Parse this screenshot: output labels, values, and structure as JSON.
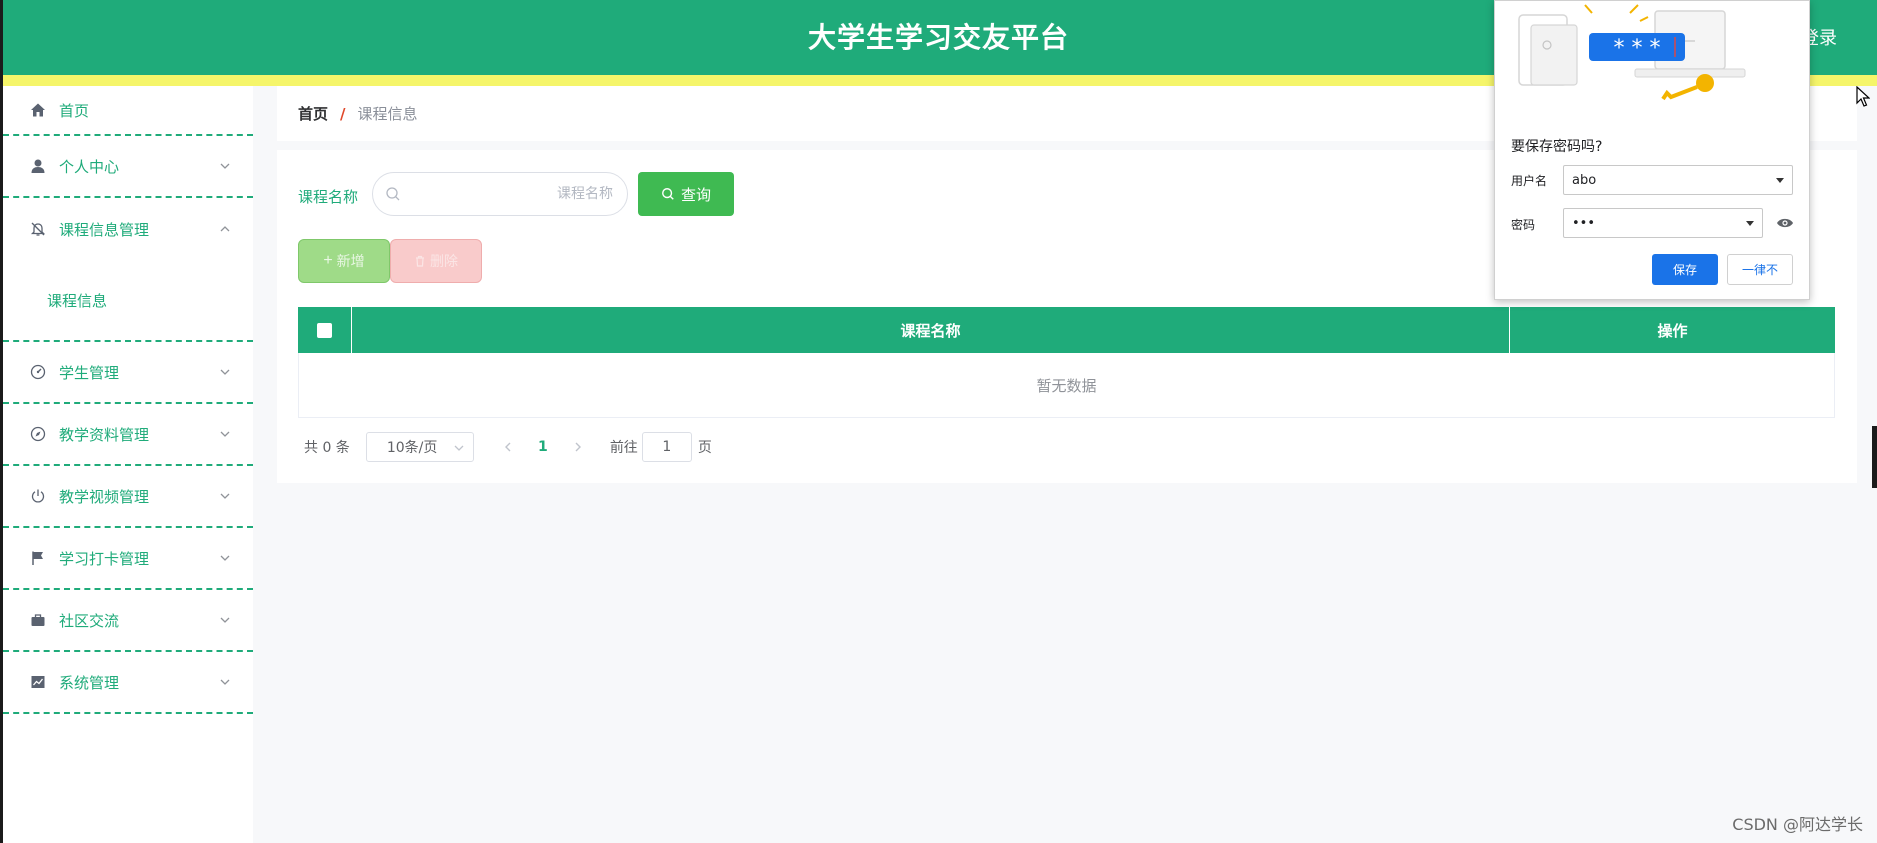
{
  "header": {
    "title": "大学生学习交友平台",
    "login_label": "登录"
  },
  "sidebar": {
    "items": [
      {
        "label": "首页",
        "icon": "home-icon"
      },
      {
        "label": "个人中心",
        "icon": "user-icon"
      },
      {
        "label": "课程信息管理",
        "icon": "bell-off-icon",
        "expanded": true,
        "children": [
          {
            "label": "课程信息"
          }
        ]
      },
      {
        "label": "学生管理",
        "icon": "dashboard-icon"
      },
      {
        "label": "教学资料管理",
        "icon": "compass-icon"
      },
      {
        "label": "教学视频管理",
        "icon": "power-icon"
      },
      {
        "label": "学习打卡管理",
        "icon": "flag-icon"
      },
      {
        "label": "社区交流",
        "icon": "briefcase-icon"
      },
      {
        "label": "系统管理",
        "icon": "chart-icon"
      }
    ]
  },
  "breadcrumb": {
    "home": "首页",
    "separator": "/",
    "current": "课程信息"
  },
  "search": {
    "label": "课程名称",
    "placeholder": "课程名称",
    "value": "",
    "query_label": "查询"
  },
  "toolbar": {
    "add_label": "新增",
    "delete_label": "删除"
  },
  "table": {
    "columns": [
      "课程名称",
      "操作"
    ],
    "rows": [],
    "empty_text": "暂无数据"
  },
  "pagination": {
    "total_text": "共 0 条",
    "page_size": "10条/页",
    "current_page": "1",
    "goto_label": "前往",
    "goto_value": "1",
    "page_unit": "页"
  },
  "password_prompt": {
    "title": "要保存密码吗?",
    "username_label": "用户名",
    "username_value": "abo",
    "password_label": "密码",
    "password_value": "•••",
    "save_label": "保存",
    "never_label": "一律不",
    "illustration_text": "* * *"
  },
  "watermark": "CSDN @阿达学长",
  "colors": {
    "primary": "#1fab7a",
    "header_stripe": "#f5f56a",
    "query_button": "#3fba52",
    "add_button": "#9fdb88",
    "delete_button": "#f9cbcb",
    "popup_accent": "#1a73e8"
  }
}
